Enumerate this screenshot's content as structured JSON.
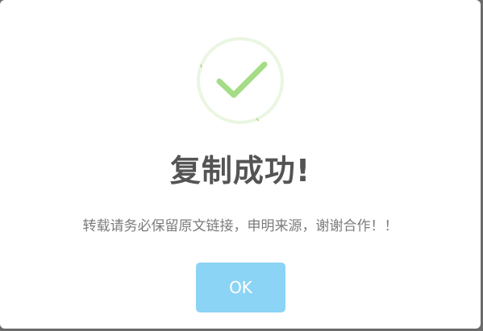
{
  "dialog": {
    "title": "复制成功!",
    "message": "转载请务必保留原文链接，申明来源，谢谢合作！！",
    "ok_label": "OK",
    "icon": "success-check-icon"
  },
  "colors": {
    "icon_ring": "#eaf6e2",
    "icon_check": "#a5dc86",
    "button_bg": "#8cd4f5",
    "title_text": "#545454",
    "message_text": "#7b7b7b"
  }
}
